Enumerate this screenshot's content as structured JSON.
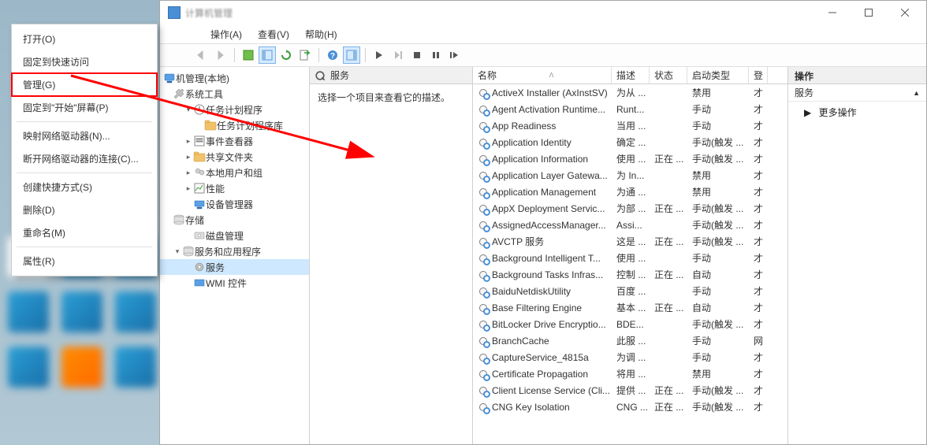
{
  "window_title": "计算机管理",
  "context_menu": {
    "open": "打开(O)",
    "pin": "固定到快速访问",
    "manage": "管理(G)",
    "pin_start": "固定到\"开始\"屏幕(P)",
    "map_drive": "映射网络驱动器(N)...",
    "disconnect_drive": "断开网络驱动器的连接(C)...",
    "create_shortcut": "创建快捷方式(S)",
    "delete": "删除(D)",
    "rename": "重命名(M)",
    "properties": "属性(R)"
  },
  "menubar": {
    "action": "操作(A)",
    "view": "查看(V)",
    "help": "帮助(H)"
  },
  "tree": {
    "root": "机管理(本地)",
    "systools": "系统工具",
    "task_scheduler": "任务计划程序",
    "task_lib": "任务计划程序库",
    "event_viewer": "事件查看器",
    "shared_folders": "共享文件夹",
    "local_users": "本地用户和组",
    "performance": "性能",
    "device_manager": "设备管理器",
    "storage": "存储",
    "disk_mgmt": "磁盘管理",
    "services_apps": "服务和应用程序",
    "services": "服务",
    "wmi": "WMI 控件"
  },
  "desc_header": "服务",
  "description_prompt": "选择一个项目来查看它的描述。",
  "columns": {
    "name": "名称",
    "desc": "描述",
    "status": "状态",
    "startup": "启动类型",
    "logon": "登"
  },
  "services": [
    {
      "name": "ActiveX Installer (AxInstSV)",
      "desc": "为从 ...",
      "status": "",
      "startup": "禁用",
      "logon": "才"
    },
    {
      "name": "Agent Activation Runtime...",
      "desc": "Runt...",
      "status": "",
      "startup": "手动",
      "logon": "才"
    },
    {
      "name": "App Readiness",
      "desc": "当用 ...",
      "status": "",
      "startup": "手动",
      "logon": "才"
    },
    {
      "name": "Application Identity",
      "desc": "确定 ...",
      "status": "",
      "startup": "手动(触发 ...",
      "logon": "才"
    },
    {
      "name": "Application Information",
      "desc": "使用 ...",
      "status": "正在 ...",
      "startup": "手动(触发 ...",
      "logon": "才"
    },
    {
      "name": "Application Layer Gatewa...",
      "desc": "为 In...",
      "status": "",
      "startup": "禁用",
      "logon": "才"
    },
    {
      "name": "Application Management",
      "desc": "为通 ...",
      "status": "",
      "startup": "禁用",
      "logon": "才"
    },
    {
      "name": "AppX Deployment Servic...",
      "desc": "为部 ...",
      "status": "正在 ...",
      "startup": "手动(触发 ...",
      "logon": "才"
    },
    {
      "name": "AssignedAccessManager...",
      "desc": "Assi...",
      "status": "",
      "startup": "手动(触发 ...",
      "logon": "才"
    },
    {
      "name": "AVCTP 服务",
      "desc": "这是 ...",
      "status": "正在 ...",
      "startup": "手动(触发 ...",
      "logon": "才"
    },
    {
      "name": "Background Intelligent T...",
      "desc": "使用 ...",
      "status": "",
      "startup": "手动",
      "logon": "才"
    },
    {
      "name": "Background Tasks Infras...",
      "desc": "控制 ...",
      "status": "正在 ...",
      "startup": "自动",
      "logon": "才"
    },
    {
      "name": "BaiduNetdiskUtility",
      "desc": "百度 ...",
      "status": "",
      "startup": "手动",
      "logon": "才"
    },
    {
      "name": "Base Filtering Engine",
      "desc": "基本 ...",
      "status": "正在 ...",
      "startup": "自动",
      "logon": "才"
    },
    {
      "name": "BitLocker Drive Encryptio...",
      "desc": "BDE...",
      "status": "",
      "startup": "手动(触发 ...",
      "logon": "才"
    },
    {
      "name": "BranchCache",
      "desc": "此服 ...",
      "status": "",
      "startup": "手动",
      "logon": "网"
    },
    {
      "name": "CaptureService_4815a",
      "desc": "为调 ...",
      "status": "",
      "startup": "手动",
      "logon": "才"
    },
    {
      "name": "Certificate Propagation",
      "desc": "将用 ...",
      "status": "",
      "startup": "禁用",
      "logon": "才"
    },
    {
      "name": "Client License Service (Cli...",
      "desc": "提供 ...",
      "status": "正在 ...",
      "startup": "手动(触发 ...",
      "logon": "才"
    },
    {
      "name": "CNG Key Isolation",
      "desc": "CNG ...",
      "status": "正在 ...",
      "startup": "手动(触发 ...",
      "logon": "才"
    }
  ],
  "actions_pane": {
    "header": "操作",
    "group": "服务",
    "more_actions": "更多操作"
  }
}
